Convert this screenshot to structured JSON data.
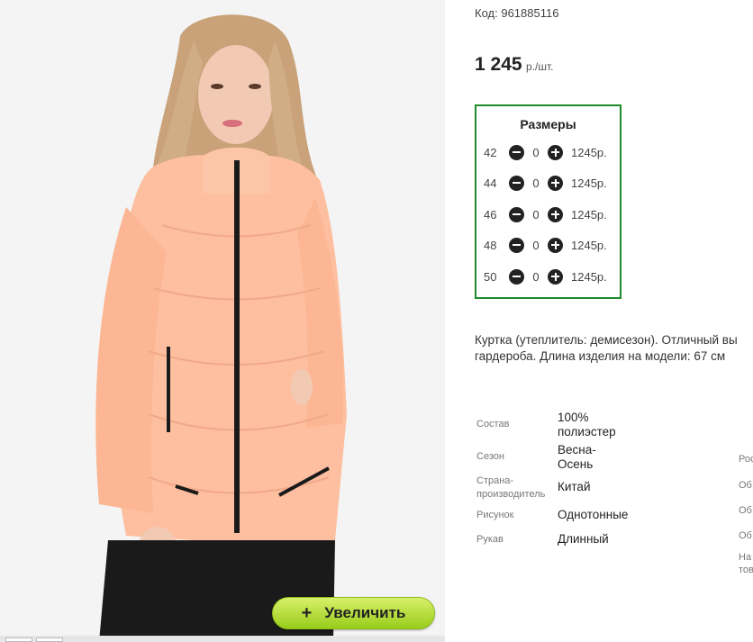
{
  "product": {
    "code_label": "Код:",
    "code": "961885116",
    "price_value": "1 245",
    "price_unit": "р./шт.",
    "zoom_button_label": "Увеличить"
  },
  "sizes": {
    "title": "Размеры",
    "rows": [
      {
        "size": "42",
        "qty": "0",
        "price": "1245р."
      },
      {
        "size": "44",
        "qty": "0",
        "price": "1245р."
      },
      {
        "size": "46",
        "qty": "0",
        "price": "1245р."
      },
      {
        "size": "48",
        "qty": "0",
        "price": "1245р."
      },
      {
        "size": "50",
        "qty": "0",
        "price": "1245р."
      }
    ]
  },
  "description": {
    "line1": "Куртка (утеплитель: демисезон). Отличный вы",
    "line2": "гардероба. Длина изделия на модели: 67 см"
  },
  "specs": [
    {
      "label": "Состав",
      "value": "100% полиэстер"
    },
    {
      "label": "Сезон",
      "value": "Весна-Осень"
    },
    {
      "label": "Страна-производитель",
      "value": "Китай"
    },
    {
      "label": "Рисунок",
      "value": "Однотонные"
    },
    {
      "label": "Рукав",
      "value": "Длинный"
    }
  ],
  "specs_right_partial": [
    "Рос",
    "Об",
    "Об",
    "Об",
    "На",
    "тов"
  ],
  "colors": {
    "jacket": "#fdbf9f",
    "zipper": "#1a1a1a",
    "sizes_border": "#1f8a2b",
    "zoom_button": "#b4dd3a"
  },
  "icons": [
    "plus-icon",
    "minus-icon"
  ]
}
